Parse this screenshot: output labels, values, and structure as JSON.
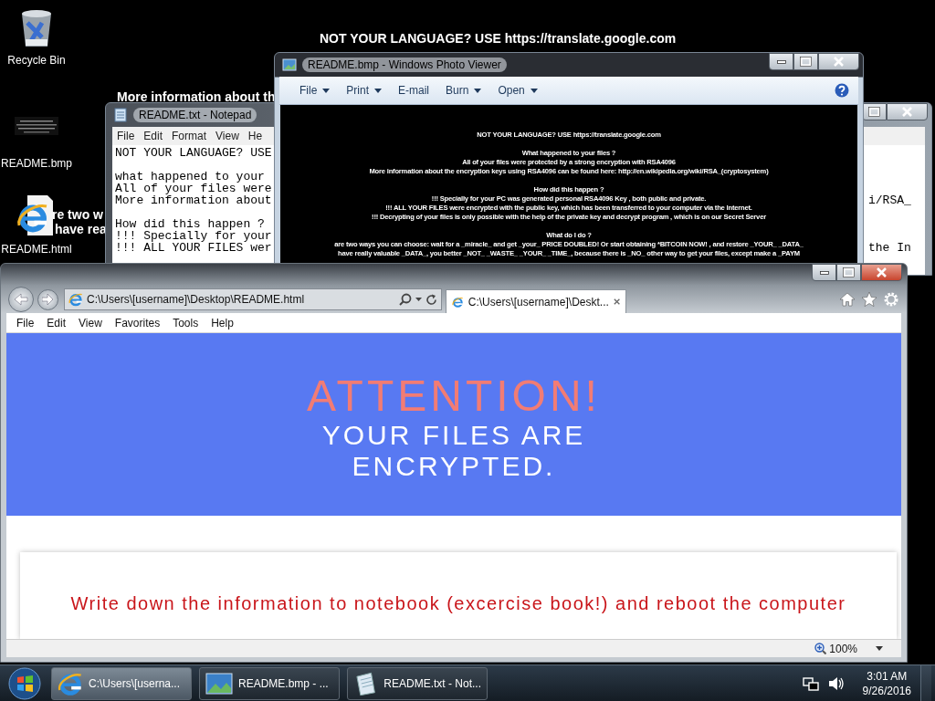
{
  "desktop": {
    "wallpaper": {
      "heading": "NOT YOUR LANGUAGE? USE https://translate.google.com",
      "fragments": [
        "More information about th",
        "re two w",
        "have rea"
      ]
    },
    "icons": [
      {
        "label": "Recycle Bin",
        "kind": "recycle-bin"
      },
      {
        "label": "README.bmp",
        "kind": "bitmap"
      },
      {
        "label": "README.html",
        "kind": "web-page"
      }
    ]
  },
  "notepad": {
    "title": "README.txt - Notepad",
    "menu": [
      "File",
      "Edit",
      "Format",
      "View",
      "He"
    ],
    "rows": [
      {
        "kind": "text",
        "left": "NOT YOUR LANGUAGE? USE"
      },
      {
        "kind": "blank"
      },
      {
        "kind": "text",
        "left": "what happened to your"
      },
      {
        "kind": "text",
        "left": "All of your files were"
      },
      {
        "kind": "text",
        "left": "More information about",
        "right": "i/RSA_"
      },
      {
        "kind": "blank"
      },
      {
        "kind": "text",
        "left": "How did this happen ?"
      },
      {
        "kind": "text",
        "left": "!!! Specially for your"
      },
      {
        "kind": "text",
        "left": "!!! ALL YOUR FILES wer",
        "right": "the In"
      }
    ]
  },
  "photo_viewer": {
    "title": "README.bmp - Windows Photo Viewer",
    "toolbar": [
      {
        "label": "File",
        "dropdown": true
      },
      {
        "label": "Print",
        "dropdown": true
      },
      {
        "label": "E-mail",
        "dropdown": false
      },
      {
        "label": "Burn",
        "dropdown": true
      },
      {
        "label": "Open",
        "dropdown": true
      }
    ],
    "image_lines": [
      {
        "kind": "text",
        "text": "NOT YOUR LANGUAGE? USE https://translate.google.com"
      },
      {
        "kind": "blank"
      },
      {
        "kind": "text",
        "text": "What happened to your files ?"
      },
      {
        "kind": "text",
        "text": "All of your files were protected by a strong encryption with RSA4096"
      },
      {
        "kind": "text",
        "text": "More information about the encryption keys using RSA4096 can be found here: http://en.wikipedia.org/wiki/RSA_(cryptosystem)"
      },
      {
        "kind": "blank"
      },
      {
        "kind": "text",
        "text": "How did this happen ?"
      },
      {
        "kind": "text",
        "text": "!!! Specially for your PC was generated personal RSA4096 Key , both public and private."
      },
      {
        "kind": "text",
        "text": "!!! ALL YOUR FILES were encrypted with the public key, which has been transferred to your computer via the Internet."
      },
      {
        "kind": "text",
        "text": "!!! Decrypting of your files is only possible with the help of the private key and decrypt program , which is on our Secret Server"
      },
      {
        "kind": "blank"
      },
      {
        "kind": "text",
        "text": "What do I do ?"
      },
      {
        "kind": "text",
        "text": "are two ways you can choose: wait for a _miracle_ and get _your_ PRICE DOUBLED! Or start obtaining *BITCOIN NOW! , and restore _YOUR_ _DATA_"
      },
      {
        "kind": "text",
        "text": "have really valuable _DATA_, you better _NOT_ _WASTE_ _YOUR_ _TIME_, because there is _NO_ other way to get your files, except make a _PAYM"
      }
    ]
  },
  "browser": {
    "address": "C:\\Users\\[username]\\Desktop\\README.html",
    "tabs": [
      {
        "label": "C:\\Users\\[username]\\Deskt...",
        "selected": true
      }
    ],
    "menu": [
      "File",
      "Edit",
      "View",
      "Favorites",
      "Tools",
      "Help"
    ],
    "page": {
      "heading": "ATTENTION!",
      "subheading": "YOUR FILES ARE ENCRYPTED.",
      "notice": "Write down the information to notebook (excercise book!) and reboot the computer"
    },
    "zoom": "100%"
  },
  "taskbar": {
    "buttons": [
      {
        "label": "C:\\Users\\[userna...",
        "kind": "browser",
        "selected": true
      },
      {
        "label": "README.bmp - ...",
        "kind": "photo",
        "selected": false
      },
      {
        "label": "README.txt - Not...",
        "kind": "notepad",
        "selected": false
      }
    ],
    "clock": {
      "time": "3:01 AM",
      "date": "9/26/2016"
    }
  }
}
